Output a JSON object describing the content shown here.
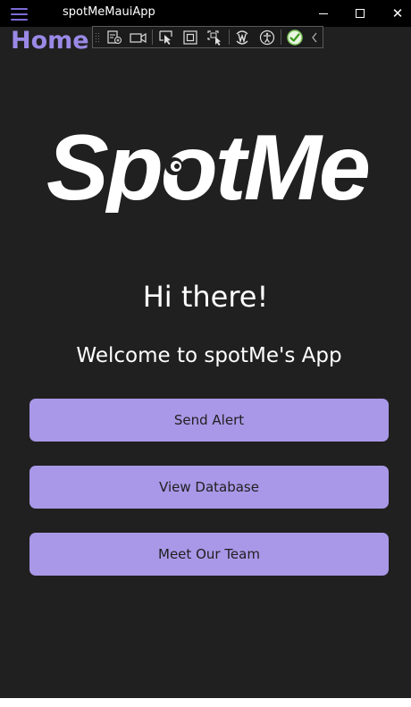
{
  "window": {
    "title": "spotMeMauiApp",
    "controls": {
      "minimize_icon": "minimize-icon",
      "maximize_icon": "maximize-icon",
      "close_icon": "close-icon",
      "close_glyph": "✕"
    }
  },
  "header": {
    "page_title": "Home",
    "menu_icon": "hamburger-menu-icon"
  },
  "debug_toolbar": {
    "icons": [
      "go-to-live-visual-tree-icon",
      "show-in-app-toolbar-icon",
      "select-element-icon",
      "display-layout-adorners-icon",
      "track-focused-element-icon",
      "hot-reload-icon",
      "accessibility-checker-icon",
      "binding-failures-ok-icon",
      "collapse-toolbar-icon"
    ]
  },
  "main": {
    "logo_text": "SpotMe",
    "greeting": "Hi there!",
    "welcome": "Welcome to spotMe's App",
    "buttons": {
      "send_alert": "Send Alert",
      "view_database": "View Database",
      "meet_team": "Meet Our Team"
    }
  },
  "colors": {
    "background": "#202020",
    "titlebar": "#000000",
    "accent": "#9a89e6",
    "button": "#a998e8",
    "button_text": "#202020",
    "text": "#ffffff"
  }
}
